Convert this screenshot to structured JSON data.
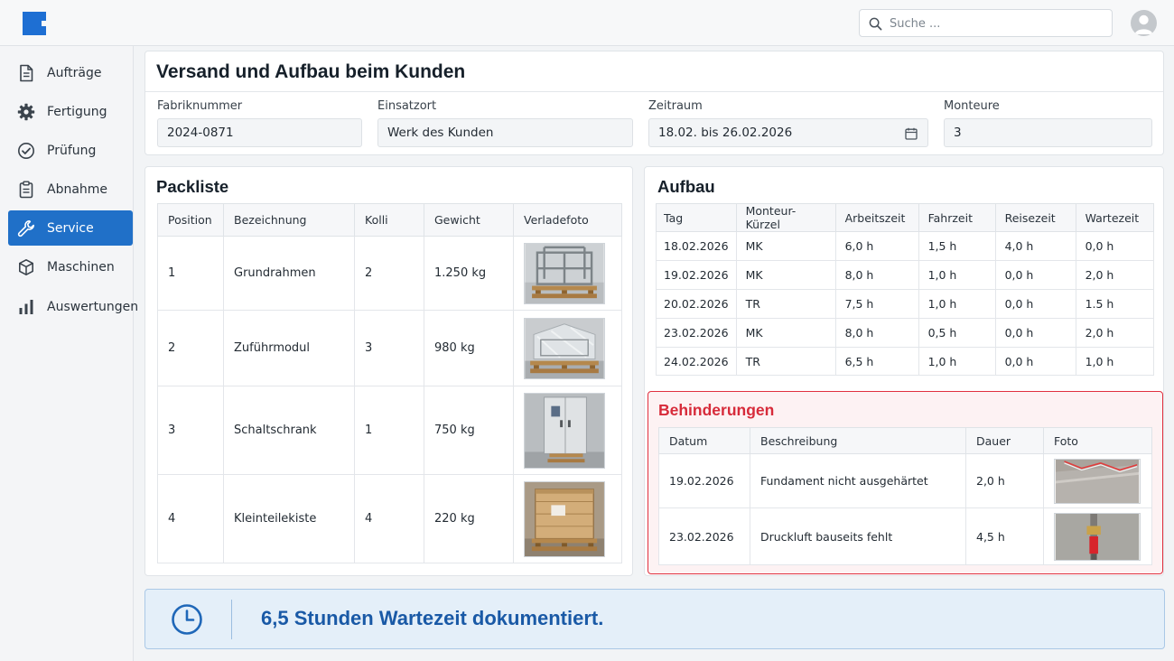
{
  "search": {
    "placeholder": "Suche ..."
  },
  "sidebar": {
    "items": [
      {
        "label": "Aufträge",
        "icon": "document-icon"
      },
      {
        "label": "Fertigung",
        "icon": "gear-icon"
      },
      {
        "label": "Prüfung",
        "icon": "check-circle-icon"
      },
      {
        "label": "Abnahme",
        "icon": "clipboard-icon"
      },
      {
        "label": "Service",
        "icon": "wrench-icon",
        "active": true
      },
      {
        "label": "Maschinen",
        "icon": "cube-icon"
      },
      {
        "label": "Auswertungen",
        "icon": "bar-chart-icon"
      }
    ]
  },
  "header": {
    "title": "Versand und Aufbau beim Kunden",
    "fields": {
      "fabriknummer": {
        "label": "Fabriknummer",
        "value": "2024-0871"
      },
      "einsatzort": {
        "label": "Einsatzort",
        "value": "Werk des Kunden"
      },
      "zeitraum": {
        "label": "Zeitraum",
        "value": "18.02. bis 26.02.2026"
      },
      "monteure": {
        "label": "Monteure",
        "value": "3"
      }
    }
  },
  "packliste": {
    "title": "Packliste",
    "columns": [
      "Position",
      "Bezeichnung",
      "Kolli",
      "Gewicht",
      "Verladefoto"
    ],
    "rows": [
      {
        "position": "1",
        "bezeichnung": "Grundrahmen",
        "kolli": "2",
        "gewicht": "1.250 kg",
        "foto": "frame-on-pallet"
      },
      {
        "position": "2",
        "bezeichnung": "Zuführmodul",
        "kolli": "3",
        "gewicht": "980 kg",
        "foto": "wrapped-module"
      },
      {
        "position": "3",
        "bezeichnung": "Schaltschrank",
        "kolli": "1",
        "gewicht": "750 kg",
        "foto": "control-cabinet"
      },
      {
        "position": "4",
        "bezeichnung": "Kleinteilekiste",
        "kolli": "4",
        "gewicht": "220 kg",
        "foto": "wooden-crate"
      }
    ]
  },
  "aufbau": {
    "title": "Aufbau",
    "columns": [
      "Tag",
      "Monteur-Kürzel",
      "Arbeitszeit",
      "Fahrzeit",
      "Reisezeit",
      "Wartezeit"
    ],
    "rows": [
      [
        "18.02.2026",
        "MK",
        "6,0 h",
        "1,5 h",
        "4,0 h",
        "0,0 h"
      ],
      [
        "19.02.2026",
        "MK",
        "8,0 h",
        "1,0 h",
        "0,0 h",
        "2,0 h"
      ],
      [
        "20.02.2026",
        "TR",
        "7,5 h",
        "1,0 h",
        "0,0 h",
        "1.5 h"
      ],
      [
        "23.02.2026",
        "MK",
        "8,0 h",
        "0,5 h",
        "0,0 h",
        "2,0 h"
      ],
      [
        "24.02.2026",
        "TR",
        "6,5 h",
        "1,0 h",
        "0,0 h",
        "1,0 h"
      ]
    ]
  },
  "behinderungen": {
    "title": "Behinderungen",
    "accent": "#e0303f",
    "columns": [
      "Datum",
      "Beschreibung",
      "Dauer",
      "Foto"
    ],
    "rows": [
      {
        "datum": "19.02.2026",
        "beschreibung": "Fundament nicht ausgehärtet",
        "dauer": "2,0 h",
        "foto": "concrete-foundation"
      },
      {
        "datum": "23.02.2026",
        "beschreibung": "Druckluft bauseits fehlt",
        "dauer": "4,5 h",
        "foto": "air-connection"
      }
    ]
  },
  "summary": {
    "text": "6,5 Stunden Wartezeit dokumentiert.",
    "icon": "clock-icon"
  }
}
